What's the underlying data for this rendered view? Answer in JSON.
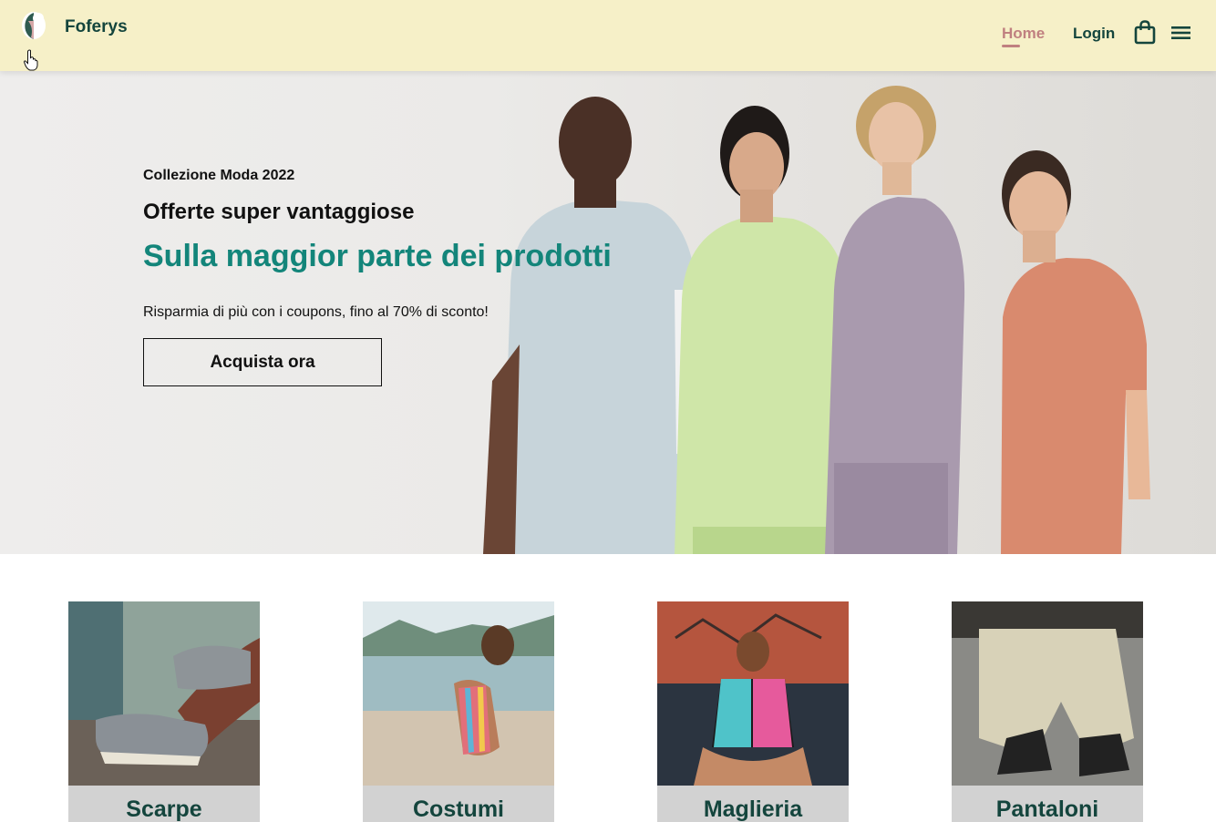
{
  "header": {
    "brand": "Foferys",
    "nav": {
      "home": "Home",
      "login": "Login"
    },
    "icons": [
      "logo-icon",
      "shopping-bag-icon",
      "menu-icon",
      "hand-cursor-icon"
    ],
    "accent_color": "#c08080",
    "brand_color": "#14453d",
    "background": "#f6f0c8"
  },
  "hero": {
    "kicker": "Collezione Moda 2022",
    "title": "Offerte super vantaggiose",
    "subtitle": "Sulla maggior parte dei prodotti",
    "description": "Risparmia di più con i coupons, fino al 70% di sconto!",
    "cta": "Acquista ora",
    "subtitle_color": "#13857a"
  },
  "categories": [
    {
      "label": "Scarpe"
    },
    {
      "label": "Costumi"
    },
    {
      "label": "Maglieria"
    },
    {
      "label": "Pantaloni"
    }
  ]
}
